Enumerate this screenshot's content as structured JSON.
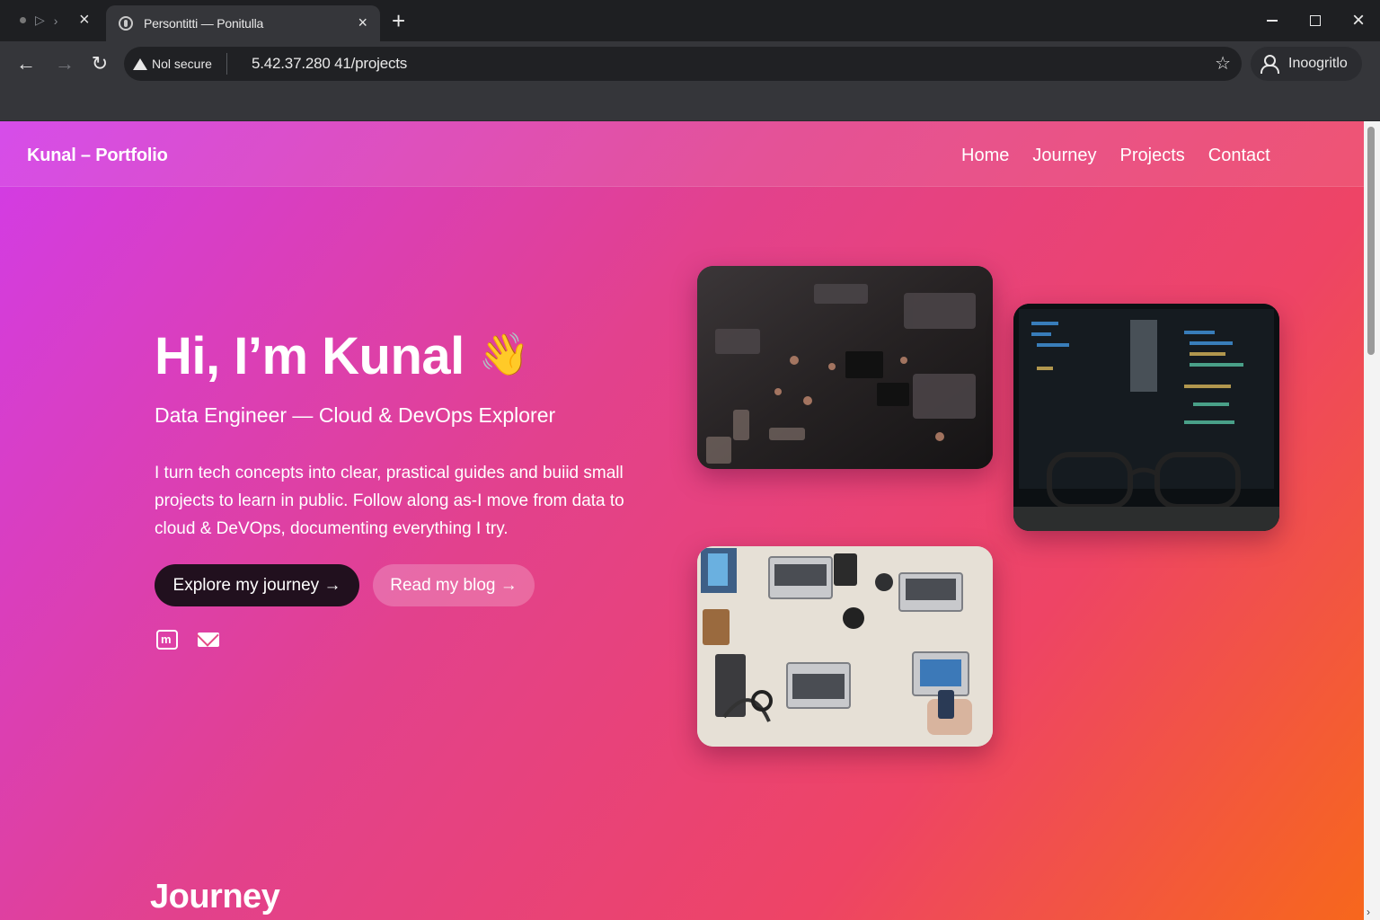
{
  "browser": {
    "tab_title": "Persontitti — Ponitulla",
    "tab_close": "×",
    "new_tab": "+",
    "security_label": "Nol secure",
    "url": "5.42.37.280 41/projects",
    "profile_label": "Inoogritlo"
  },
  "site": {
    "brand": "Kunal – Portfolio",
    "nav": [
      "Home",
      "Journey",
      "Projects",
      "Contact"
    ],
    "hero": {
      "title": "Hi, I’m Kunal",
      "wave": "👋",
      "subtitle": "Data Engineer — Cloud & DevOps Explorer",
      "body": "I turn tech concepts into clear, prastical guides and buiid small projects to learn in public. Follow along as-I move from data to cloud & DeVOps, documenting everything I try.",
      "primary_button": "Explore my journey →",
      "secondary_button": "Read my blog →"
    },
    "social_icons": [
      "linkedin-icon",
      "mail-icon"
    ],
    "images": [
      "circuit-board-photo",
      "code-screen-glasses-photo",
      "desk-laptops-photo"
    ],
    "section_title": "Journey"
  },
  "colors": {
    "gradient_start": "#d23ce8",
    "gradient_mid": "#e2418d",
    "gradient_end": "#f7671c",
    "primary_button_bg": "#21101e"
  }
}
